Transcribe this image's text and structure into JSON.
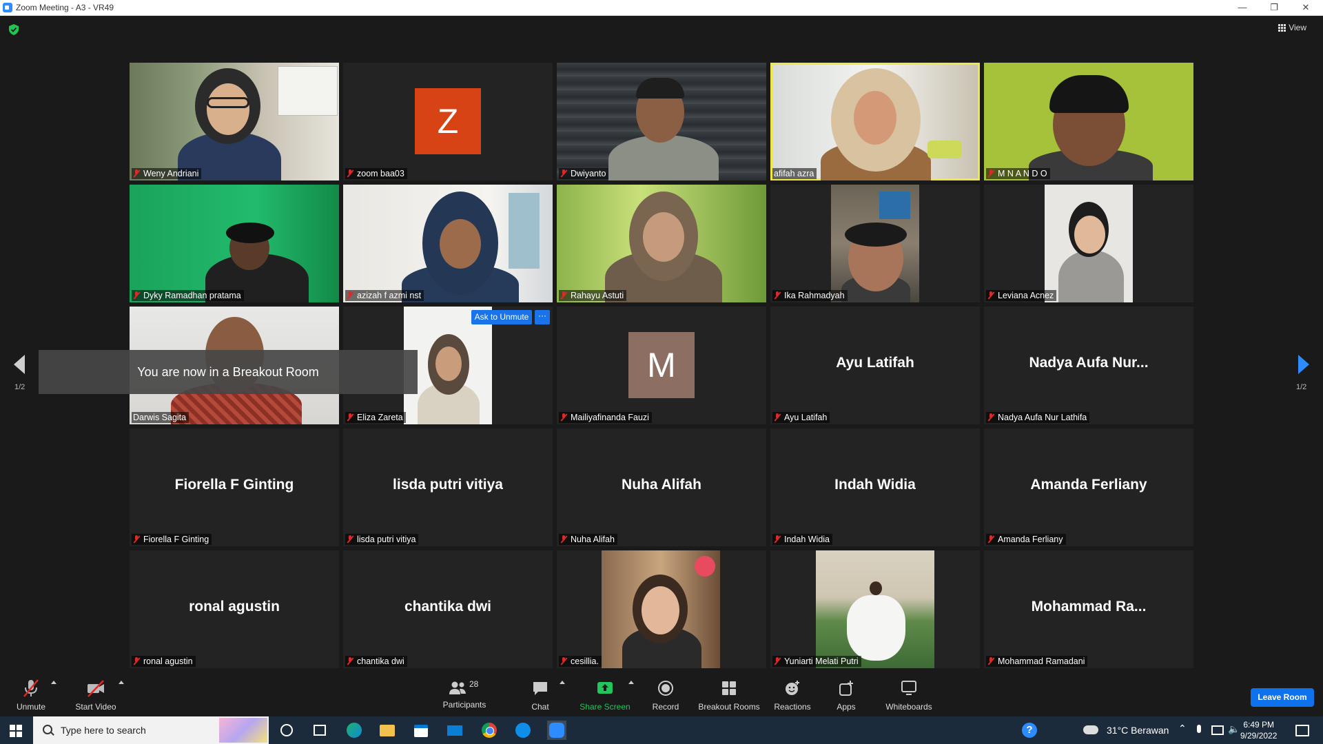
{
  "window": {
    "title": "Zoom Meeting - A3 - VR49"
  },
  "view_label": "View",
  "pagination": {
    "prev_page": "1/2",
    "next_page": "1/2"
  },
  "toast": "You are now in a Breakout Room",
  "ask_to_unmute": "Ask to Unmute",
  "more_label": "···",
  "tiles": [
    {
      "name": "Weny Andriani"
    },
    {
      "name": "zoom baa03",
      "avatar_letter": "Z"
    },
    {
      "name": "Dwiyanto"
    },
    {
      "name": "afifah azra"
    },
    {
      "name": "M  N A N D O"
    },
    {
      "name": "Dyky Ramadhan pratama"
    },
    {
      "name": "azizah f azmi nst"
    },
    {
      "name": "Rahayu Astuti"
    },
    {
      "name": "Ika Rahmadyah"
    },
    {
      "name": "Leviana Acnez"
    },
    {
      "name": "Darwis Sagita"
    },
    {
      "name": "Eliza Zareta"
    },
    {
      "name": "Mailiyafinanda Fauzi",
      "avatar_letter": "M"
    },
    {
      "name": "Ayu Latifah",
      "display": "Ayu Latifah"
    },
    {
      "name": "Nadya Aufa Nur Lathifa",
      "display": "Nadya  Aufa  Nur..."
    },
    {
      "name": "Fiorella F Ginting",
      "display": "Fiorella F Ginting"
    },
    {
      "name": "lisda putri vitiya",
      "display": "lisda putri vitiya"
    },
    {
      "name": "Nuha Alifah",
      "display": "Nuha Alifah"
    },
    {
      "name": "Indah Widia",
      "display": "Indah Widia"
    },
    {
      "name": "Amanda Ferliany",
      "display": "Amanda Ferliany"
    },
    {
      "name": "ronal agustin",
      "display": "ronal agustin"
    },
    {
      "name": "chantika dwi",
      "display": "chantika dwi"
    },
    {
      "name": "cesillia."
    },
    {
      "name": "Yuniarti Melati Putri"
    },
    {
      "name": "Mohammad Ramadani",
      "display": "Mohammad   Ra..."
    }
  ],
  "toolbar": {
    "unmute": "Unmute",
    "start_video": "Start Video",
    "participants": "Participants",
    "participants_count": "28",
    "chat": "Chat",
    "share_screen": "Share Screen",
    "record": "Record",
    "breakout_rooms": "Breakout Rooms",
    "reactions": "Reactions",
    "apps": "Apps",
    "whiteboards": "Whiteboards",
    "leave_room": "Leave Room"
  },
  "taskbar": {
    "search_placeholder": "Type here to search",
    "weather": "31°C  Berawan",
    "time": "6:49 PM",
    "date": "9/29/2022"
  },
  "colors": {
    "accent_blue": "#2d8cff",
    "active_speaker": "#f0e64a",
    "share_green": "#22c55e",
    "muted_red": "#e02828"
  }
}
